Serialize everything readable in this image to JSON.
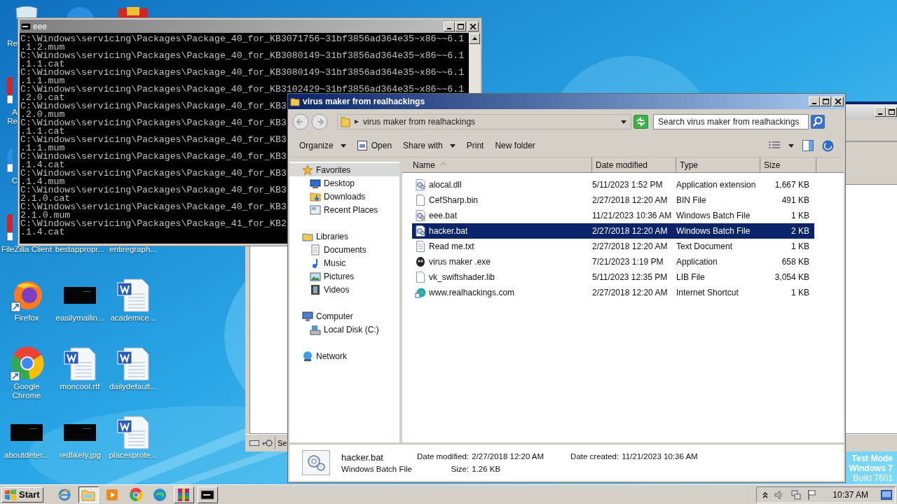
{
  "desktop": {
    "icons": [
      {
        "kind": "bin",
        "label": "Re",
        "covered": true
      },
      {
        "kind": "red-app",
        "label": "A\nRe",
        "covered": true
      },
      {
        "kind": "blue-app",
        "label": "C",
        "covered": true
      },
      {
        "kind": "red-app",
        "label": "FileZilla Client",
        "covered": false
      },
      {
        "kind": "firefox",
        "label": "Firefox",
        "covered": false
      },
      {
        "kind": "chrome",
        "label": "Google Chrome",
        "covered": false
      },
      {
        "kind": "thumbnail",
        "label": "aboutdeter...",
        "covered": false
      },
      {
        "kind": "blue-app"
      },
      {
        "kind": "covered",
        "label": "bestappropr...",
        "covered": false
      },
      {
        "kind": "thumbnail",
        "label": "easilymailin...",
        "covered": false
      },
      {
        "kind": "word",
        "label": "moncool.rtf",
        "covered": false
      },
      {
        "kind": "thumbnail",
        "label": "redlikely.jpg",
        "covered": false
      },
      {
        "kind": "red-app"
      },
      {
        "kind": "covered",
        "label": "entiregraph...",
        "covered": false
      },
      {
        "kind": "word",
        "label": "academice...",
        "covered": false
      },
      {
        "kind": "word",
        "label": "dailydefault...",
        "covered": false
      },
      {
        "kind": "word",
        "label": "placesprote...",
        "covered": false
      }
    ],
    "os_notice": [
      "Test Mode",
      "Windows 7",
      "Build 7601"
    ]
  },
  "console_window": {
    "title": "eee",
    "lines": [
      "C:\\Windows\\servicing\\Packages\\Package_40_for_KB3071756~31bf3856ad364e35~x86~~6.1",
      ".1.2.mum",
      "C:\\Windows\\servicing\\Packages\\Package_40_for_KB3080149~31bf3856ad364e35~x86~~6.1",
      ".1.1.cat",
      "C:\\Windows\\servicing\\Packages\\Package_40_for_KB3080149~31bf3856ad364e35~x86~~6.1",
      ".1.1.mum",
      "C:\\Windows\\servicing\\Packages\\Package_40_for_KB3102429~31bf3856ad364e35~x86~~6.1",
      ".2.0.cat",
      "C:\\Windows\\servicing\\Packages\\Package_40_for_KB3",
      ".2.0.mum",
      "C:\\Windows\\servicing\\Packages\\Package_40_for_KB3",
      ".1.1.cat",
      "C:\\Windows\\servicing\\Packages\\Package_40_for_KB3",
      ".1.1.mum",
      "C:\\Windows\\servicing\\Packages\\Package_40_for_KB3",
      ".1.4.cat",
      "C:\\Windows\\servicing\\Packages\\Package_40_for_KB3",
      ".1.4.mum",
      "C:\\Windows\\servicing\\Packages\\Package_40_for_KB3",
      "2.1.0.cat",
      "C:\\Windows\\servicing\\Packages\\Package_40_for_KB3",
      "2.1.0.mum",
      "C:\\Windows\\servicing\\Packages\\Package_41_for_KB2",
      ".1.4.cat"
    ]
  },
  "background_window": {
    "status_text": "Se"
  },
  "explorer": {
    "title": "virus maker from realhackings",
    "address": "virus maker from realhackings",
    "search": {
      "placeholder": "Search virus maker from realhackings"
    },
    "toolbar": [
      {
        "label": "Organize",
        "kind": "plain",
        "dropdown": true
      },
      {
        "label": "Open",
        "kind": "with-icon",
        "dropdown": false
      },
      {
        "label": "Share with",
        "kind": "plain",
        "dropdown": true
      },
      {
        "label": "Print",
        "kind": "plain",
        "dropdown": false
      },
      {
        "label": "New folder",
        "kind": "plain",
        "dropdown": false
      }
    ],
    "nav": [
      {
        "label": "Favorites",
        "kind": "star",
        "selected": true,
        "children": [
          {
            "label": "Desktop",
            "kind": "desktop",
            "selected": false
          },
          {
            "label": "Downloads",
            "kind": "downloads",
            "selected": false
          },
          {
            "label": "Recent Places",
            "kind": "recent",
            "selected": false
          }
        ]
      },
      {
        "label": "Libraries",
        "kind": "library",
        "selected": false,
        "children": [
          {
            "label": "Documents",
            "kind": "documents",
            "selected": false
          },
          {
            "label": "Music",
            "kind": "music",
            "selected": false
          },
          {
            "label": "Pictures",
            "kind": "pictures",
            "selected": false
          },
          {
            "label": "Videos",
            "kind": "videos",
            "selected": false
          }
        ]
      },
      {
        "label": "Computer",
        "kind": "computer",
        "selected": false,
        "children": [
          {
            "label": "Local Disk (C:)",
            "kind": "disk",
            "selected": false
          }
        ]
      },
      {
        "label": "Network",
        "kind": "network",
        "selected": false
      }
    ],
    "columns": [
      {
        "label": "Name",
        "sorted": true
      },
      {
        "label": "Date modified",
        "sorted": false
      },
      {
        "label": "Type",
        "sorted": false
      },
      {
        "label": "Size",
        "sorted": false
      }
    ],
    "files": [
      {
        "name": "alocal.dll",
        "date": "5/11/2023 1:52 PM",
        "type": "Application extension",
        "size": "1,667 KB",
        "kind": "gear",
        "selected": false
      },
      {
        "name": "CefSharp.bin",
        "date": "2/27/2018 12:20 AM",
        "type": "BIN File",
        "size": "491 KB",
        "kind": "blank",
        "selected": false
      },
      {
        "name": "eee.bat",
        "date": "11/21/2023 10:36 AM",
        "type": "Windows Batch File",
        "size": "1 KB",
        "kind": "gear",
        "selected": false
      },
      {
        "name": "hacker.bat",
        "date": "2/27/2018 12:20 AM",
        "type": "Windows Batch File",
        "size": "2 KB",
        "kind": "gear",
        "selected": true
      },
      {
        "name": "Read me.txt",
        "date": "2/27/2018 12:20 AM",
        "type": "Text Document",
        "size": "1 KB",
        "kind": "text",
        "selected": false
      },
      {
        "name": "virus maker .exe",
        "date": "7/21/2023 1:19 PM",
        "type": "Application",
        "size": "658 KB",
        "kind": "app",
        "selected": false
      },
      {
        "name": "vk_swiftshader.lib",
        "date": "5/11/2023 12:35 PM",
        "type": "LIB File",
        "size": "3,054 KB",
        "kind": "blank",
        "selected": false
      },
      {
        "name": "www.realhackings.com",
        "date": "2/27/2018 12:20 AM",
        "type": "Internet Shortcut",
        "size": "1 KB",
        "kind": "web",
        "selected": false
      }
    ],
    "details": {
      "name": "hacker.bat",
      "type": "Windows Batch File",
      "fields": [
        {
          "label": "Date modified:",
          "value": "2/27/2018 12:20 AM"
        },
        {
          "label": "Size:",
          "value": "1.26 KB"
        },
        {
          "label": "Date created:",
          "value": "11/21/2023 10:36 AM"
        }
      ]
    }
  },
  "taskbar": {
    "start": "Start",
    "apps": [
      {
        "kind": "ie",
        "selected": false,
        "running": false
      },
      {
        "kind": "explorer",
        "selected": true,
        "running": true
      },
      {
        "kind": "media",
        "selected": false,
        "running": false
      },
      {
        "kind": "chrome",
        "selected": false,
        "running": false
      },
      {
        "kind": "edge",
        "selected": false,
        "running": false
      },
      {
        "kind": "archive",
        "selected": false,
        "running": true
      },
      {
        "kind": "console",
        "selected": false,
        "running": true
      }
    ],
    "clock": "10:37 AM"
  }
}
